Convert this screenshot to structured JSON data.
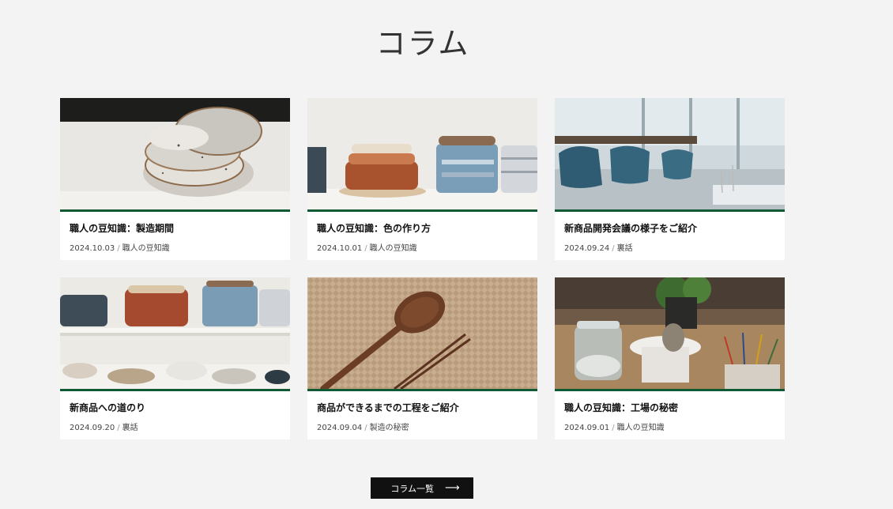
{
  "page": {
    "title": "コラム"
  },
  "columns": [
    {
      "title": "職人の豆知識：製造期間",
      "date": "2024.10.03",
      "category": "職人の豆知識",
      "image": "speckled-bowls-photo"
    },
    {
      "title": "職人の豆知識：色の作り方",
      "date": "2024.10.01",
      "category": "職人の豆知識",
      "image": "plate-stacks-photo"
    },
    {
      "title": "新商品開発会議の様子をご紹介",
      "date": "2024.09.24",
      "category": "裏話",
      "image": "meeting-room-photo"
    },
    {
      "title": "新商品への道のり",
      "date": "2024.09.20",
      "category": "裏話",
      "image": "dish-shelves-photo"
    },
    {
      "title": "商品ができるまでの工程をご紹介",
      "date": "2024.09.04",
      "category": "製造の秘密",
      "image": "wooden-spoon-chopsticks-photo"
    },
    {
      "title": "職人の豆知識：工場の秘密",
      "date": "2024.09.01",
      "category": "職人の豆知識",
      "image": "workshop-table-photo"
    }
  ],
  "more_button": {
    "label": "コラム一覧",
    "icon": "arrow-right-icon"
  },
  "colors": {
    "background": "#f3f3f3",
    "accent_line": "#0f5a35",
    "button": "#111111"
  }
}
